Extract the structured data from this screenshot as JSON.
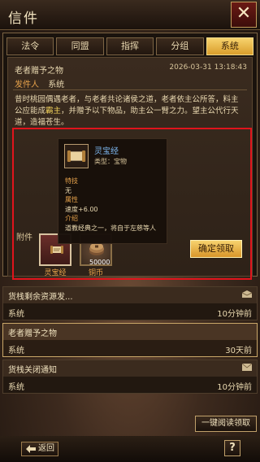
{
  "window": {
    "title": "信件",
    "close_glyph": "✕"
  },
  "tabs": [
    {
      "label": "法令",
      "active": false
    },
    {
      "label": "同盟",
      "active": false
    },
    {
      "label": "指挥",
      "active": false
    },
    {
      "label": "分组",
      "active": false
    },
    {
      "label": "系统",
      "active": true
    }
  ],
  "mail": {
    "subject": "老者赠予之物",
    "datetime": "2026-03-31 13:18:43",
    "sender_label": "发件人",
    "sender": "系统",
    "body_part1": "昔时桃园偶遇老者，与老者共论诸侯之道，老者依主公所答，料主公应能成",
    "body_highlight": "霸主",
    "body_part2": "，并赠予以下物品，助主公一臂之力。望主公代行天道，造福苍生。",
    "attachments_label": "附件",
    "attachments": [
      {
        "name": "灵宝经",
        "icon": "scroll-icon",
        "qty": ""
      },
      {
        "name": "铜币",
        "icon": "coin-icon",
        "qty": "50000"
      }
    ],
    "confirm_label": "确定领取"
  },
  "tooltip": {
    "title": "灵宝经",
    "type_line": "类型：宝物",
    "lines": [
      {
        "text": "特技",
        "kind": "k"
      },
      {
        "text": "无",
        "kind": ""
      },
      {
        "text": "属性",
        "kind": "k"
      },
      {
        "text": "速度+6.00",
        "kind": ""
      },
      {
        "text": "介绍",
        "kind": "k"
      },
      {
        "text": "道教经典之一，将自于左慈等人",
        "kind": ""
      }
    ]
  },
  "mail_list": [
    {
      "title": "货栈剩余资源发...",
      "sender": "系统",
      "time": "10分钟前",
      "icon": "mail-opened-icon",
      "selected": false
    },
    {
      "title": "老者赠予之物",
      "sender": "系统",
      "time": "30天前",
      "icon": "",
      "selected": true
    },
    {
      "title": "货栈关闭通知",
      "sender": "系统",
      "time": "10分钟前",
      "icon": "mail-icon",
      "selected": false
    }
  ],
  "footer": {
    "read_all_label": "一键阅读领取",
    "back_label": "返回",
    "help_label": "?"
  },
  "colors": {
    "accent_gold": "#f0c860",
    "highlight_frame": "#e0141c",
    "tooltip_title": "#7db7f0"
  }
}
